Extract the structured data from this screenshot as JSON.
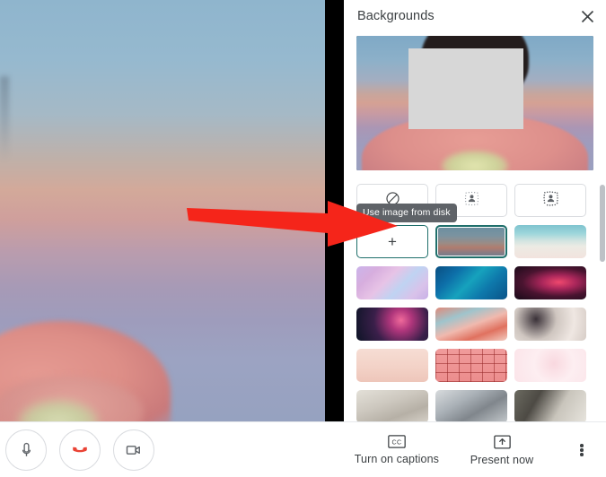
{
  "panel": {
    "title": "Backgrounds",
    "close_icon": "close-icon",
    "tooltip": "Use image from disk",
    "preview": {
      "alt": "self-view-preview",
      "privacy_overlay": "gray-privacy-box"
    },
    "options": [
      {
        "id": "no-effect",
        "kind": "icon",
        "icon": "no-effect-icon",
        "label": "No effect",
        "selected": false
      },
      {
        "id": "blur-slight",
        "kind": "icon",
        "icon": "slight-blur-icon",
        "label": "Slightly blur background",
        "selected": false
      },
      {
        "id": "blur-full",
        "kind": "icon",
        "icon": "blur-icon",
        "label": "Blur background",
        "selected": false
      },
      {
        "id": "add-image",
        "kind": "add",
        "icon": "plus-icon",
        "label": "Use image from disk",
        "selected": false,
        "outlined": true
      },
      {
        "id": "bg-sunset",
        "kind": "image",
        "label": "Sunset gradient",
        "selected": true,
        "color": "#6b8c9b"
      },
      {
        "id": "bg-beach",
        "kind": "image",
        "label": "Beach",
        "selected": false,
        "color": "#a9d3d2"
      },
      {
        "id": "bg-clouds",
        "kind": "image",
        "label": "Pink clouds",
        "selected": false,
        "color": "#c5a8e0"
      },
      {
        "id": "bg-water",
        "kind": "image",
        "label": "Blue water",
        "selected": false,
        "color": "#0b5a8c"
      },
      {
        "id": "bg-nebula",
        "kind": "image",
        "label": "Red nebula",
        "selected": false,
        "color": "#2a1320"
      },
      {
        "id": "bg-fireworks",
        "kind": "image",
        "label": "Fireworks",
        "selected": false,
        "color": "#141d33"
      },
      {
        "id": "bg-blossom",
        "kind": "image",
        "label": "Cherry blossom",
        "selected": false,
        "color": "#e0897f"
      },
      {
        "id": "bg-confetti",
        "kind": "image",
        "label": "Confetti petals",
        "selected": false,
        "color": "#d8cfc8"
      },
      {
        "id": "bg-peach",
        "kind": "image",
        "label": "Peach haze",
        "selected": false,
        "color": "#f2d3cb"
      },
      {
        "id": "bg-grid",
        "kind": "image",
        "label": "Pink grid",
        "selected": false,
        "color": "#ef9a9a"
      },
      {
        "id": "bg-speckle",
        "kind": "image",
        "label": "Pink speckle",
        "selected": false,
        "color": "#fbe9ec"
      },
      {
        "id": "bg-office",
        "kind": "image",
        "label": "Office",
        "selected": false,
        "color": "#cfcdc6"
      },
      {
        "id": "bg-lobby",
        "kind": "image",
        "label": "Lobby",
        "selected": false,
        "color": "#b9bdc2"
      },
      {
        "id": "bg-livingroom",
        "kind": "image",
        "label": "Living room",
        "selected": false,
        "color": "#7f7c74"
      }
    ]
  },
  "stage": {
    "alt": "self-view-video-feed"
  },
  "annotation": {
    "arrow_color": "#f5251a",
    "points_to": "add-image-option"
  },
  "bottom_bar": {
    "mic_label": "Turn off microphone",
    "hangup_label": "Leave call",
    "camera_label": "Turn off camera",
    "captions_label": "Turn on captions",
    "present_label": "Present now",
    "more_label": "More options"
  },
  "colors": {
    "accent": "#1f6f6b",
    "hangup": "#ea4335",
    "tooltip_bg": "#5f6368",
    "text": "#3c4043"
  }
}
